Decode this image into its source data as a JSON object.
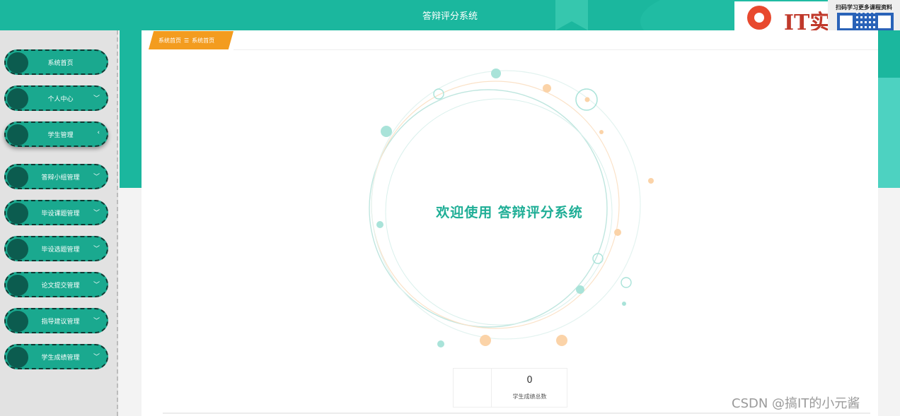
{
  "header": {
    "title": "答辩评分系统"
  },
  "logo": {
    "text": "IT实"
  },
  "qr": {
    "caption": "扫码学习更多课程资料"
  },
  "sidebar": {
    "items": [
      {
        "label": "系统首页",
        "chevron": ""
      },
      {
        "label": "个人中心",
        "chevron": "﹀"
      },
      {
        "label": "学生管理",
        "chevron": "‹"
      },
      {
        "label": "答辩小组管理",
        "chevron": "﹀"
      },
      {
        "label": "毕设课题管理",
        "chevron": "﹀"
      },
      {
        "label": "毕设选题管理",
        "chevron": "﹀"
      },
      {
        "label": "论文提交管理",
        "chevron": "﹀"
      },
      {
        "label": "指导建议管理",
        "chevron": "﹀"
      },
      {
        "label": "学生成绩管理",
        "chevron": "﹀"
      }
    ]
  },
  "breadcrumb": {
    "home": "系统首页",
    "separator": "☰",
    "current": "系统首页"
  },
  "welcome": {
    "text": "欢迎使用 答辩评分系统"
  },
  "stat": {
    "value": "0",
    "label": "学生成绩总数"
  },
  "watermark": {
    "text": "CSDN @搞IT的小元酱"
  },
  "colors": {
    "primary": "#1bb79e",
    "accent": "#f39c1f",
    "dark": "#0c5c4f"
  }
}
